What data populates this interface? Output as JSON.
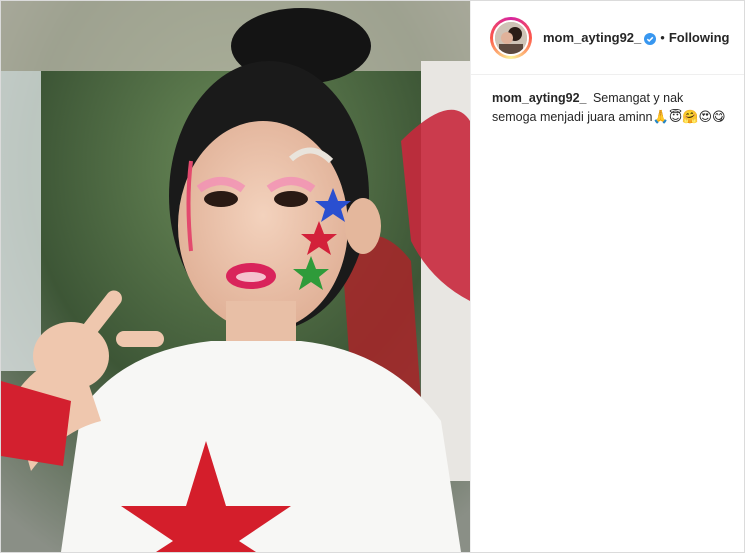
{
  "post": {
    "author": {
      "username": "mom_ayting92_",
      "verified_icon": "verified-badge-icon",
      "separator": "•",
      "follow_status": "Following"
    },
    "caption": {
      "username": "mom_ayting92_",
      "text": "Semangat y nak semoga menjadi juara aminn",
      "emojis": "🙏😇🤗😍😋"
    },
    "photo": {
      "subject": "child-with-face-paint-photo"
    }
  },
  "colors": {
    "verified_blue": "#3897f0",
    "text": "#262626",
    "border": "#dbdbdb"
  }
}
